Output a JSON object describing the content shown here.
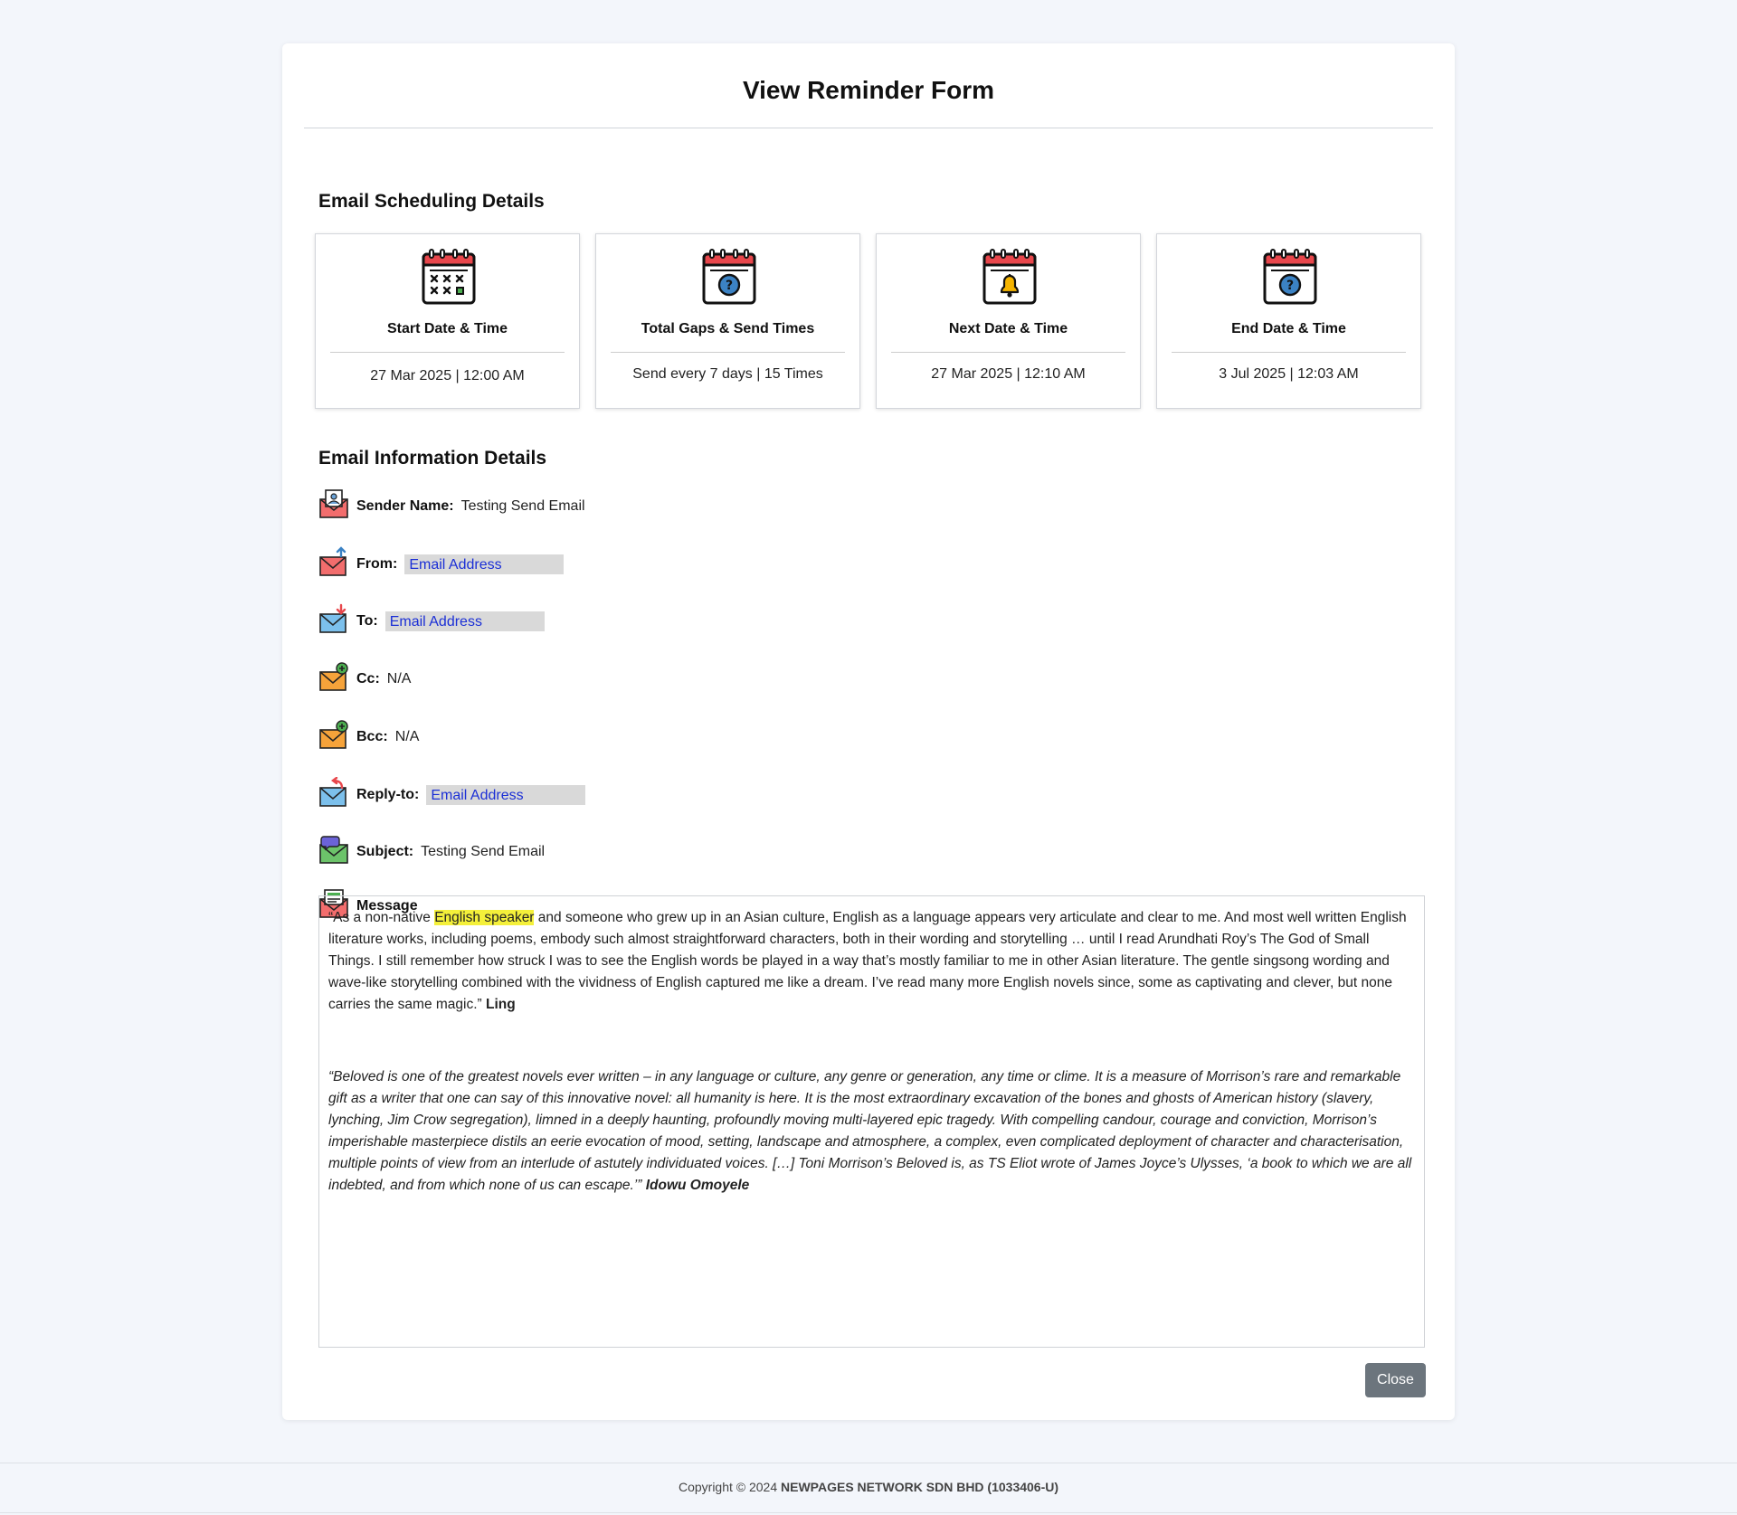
{
  "modal": {
    "title": "View Reminder Form",
    "close_label": "Close"
  },
  "scheduling": {
    "heading": "Email Scheduling Details",
    "items": [
      {
        "icon": "calendar-schedule-icon",
        "label": "Start Date & Time",
        "value": "27 Mar 2025 | 12:00 AM"
      },
      {
        "icon": "calendar-question-icon",
        "label": "Total Gaps & Send Times",
        "value": "Send every 7 days | 15 Times"
      },
      {
        "icon": "calendar-bell-icon",
        "label": "Next Date & Time",
        "value": "27 Mar 2025 | 12:10 AM"
      },
      {
        "icon": "calendar-question-icon",
        "label": "End Date & Time",
        "value": "3 Jul 2025 | 12:03 AM"
      }
    ]
  },
  "info": {
    "heading": "Email Information Details",
    "sender_name_label": "Sender Name:",
    "sender_name_value": "Testing Send Email",
    "from_label": "From:",
    "from_value": "Email Address",
    "to_label": "To:",
    "to_value": "Email Address",
    "cc_label": "Cc:",
    "cc_value": "N/A",
    "bcc_label": "Bcc:",
    "bcc_value": "N/A",
    "reply_to_label": "Reply-to:",
    "reply_to_value": "Email Address",
    "subject_label": "Subject:",
    "subject_value": "Testing Send Email",
    "message_label": "Message"
  },
  "message": {
    "p1_before": "“As a non-native ",
    "p1_highlight": "English speaker",
    "p1_after": " and someone who grew up in an Asian culture, English as a language appears very articulate and clear to me. And most well written English literature works, including poems, embody such almost straightforward characters, both in their wording and storytelling … until I read Arundhati Roy’s The God of Small Things. I still remember how struck I was to see the English words be played in a way that’s mostly familiar to me in other Asian literature. The gentle singsong wording and wave-like storytelling combined with the vividness of English captured me like a dream. I’ve read many more English novels since, some as captivating and clever, but none carries the same magic.”",
    "p1_author": "Ling",
    "p2_text": "“Beloved is one of the greatest novels ever written – in any language or culture, any genre or generation, any time or clime. It is a measure of Morrison’s rare and remarkable gift as a writer that one can say of this innovative novel: all humanity is here. It is the most extraordinary excavation of the bones and ghosts of American history (slavery, lynching, Jim Crow segregation), limned in a deeply haunting, profoundly moving multi-layered epic tragedy. With compelling candour, courage and conviction, Morrison’s imperishable masterpiece distils an eerie evocation of mood, setting, landscape and atmosphere, a complex, even complicated deployment of character and characterisation, multiple points of view from an interlude of astutely individuated voices. […] Toni Morrison’s Beloved is, as TS Eliot wrote of James Joyce’s Ulysses, ‘a book to which we are all indebted, and from which none of us can escape.’”",
    "p2_author": "Idowu Omoyele"
  },
  "footer": {
    "prefix": "Copyright © 2024 ",
    "company": "NEWPAGES NETWORK SDN BHD (1033406-U)"
  }
}
